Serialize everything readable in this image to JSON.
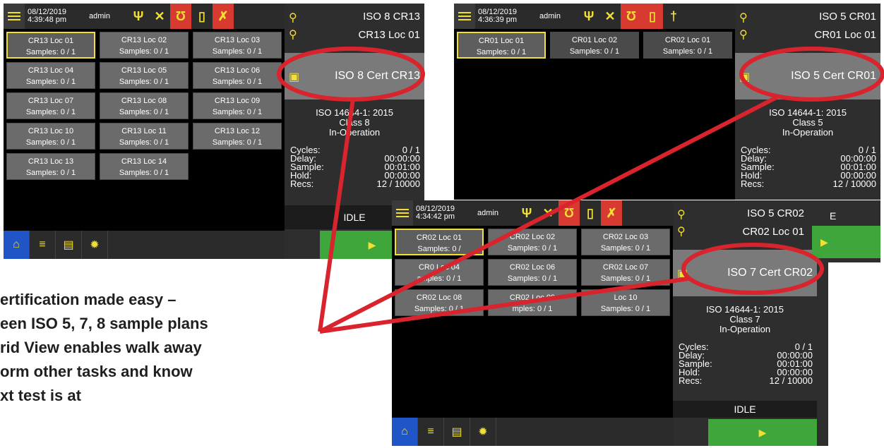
{
  "screen_a": {
    "date": "08/12/2019",
    "time": "4:39:48 pm",
    "user": "admin",
    "header_line1": "ISO 8 CR13",
    "header_line2": "CR13 Loc 01",
    "cert": "ISO 8 Cert CR13",
    "standard": "ISO 14644-1: 2015",
    "class": "Class 8",
    "mode": "In-Operation",
    "stats": [
      {
        "label": "Cycles:",
        "value": "0 / 1"
      },
      {
        "label": "Delay:",
        "value": "00:00:00"
      },
      {
        "label": "Sample:",
        "value": "00:01:00"
      },
      {
        "label": "Hold:",
        "value": "00:00:00"
      },
      {
        "label": "Recs:",
        "value": "12 / 10000"
      }
    ],
    "status": "IDLE",
    "locations": [
      {
        "name": "CR13 Loc 01",
        "samples": "Samples: 0 / 1"
      },
      {
        "name": "CR13 Loc 02",
        "samples": "Samples: 0 / 1"
      },
      {
        "name": "CR13 Loc 03",
        "samples": "Samples: 0 / 1"
      },
      {
        "name": "CR13 Loc 04",
        "samples": "Samples: 0 / 1"
      },
      {
        "name": "CR13 Loc 05",
        "samples": "Samples: 0 / 1"
      },
      {
        "name": "CR13 Loc 06",
        "samples": "Samples: 0 / 1"
      },
      {
        "name": "CR13 Loc 07",
        "samples": "Samples: 0 / 1"
      },
      {
        "name": "CR13 Loc 08",
        "samples": "Samples: 0 / 1"
      },
      {
        "name": "CR13 Loc 09",
        "samples": "Samples: 0 / 1"
      },
      {
        "name": "CR13 Loc 10",
        "samples": "Samples: 0 / 1"
      },
      {
        "name": "CR13 Loc 11",
        "samples": "Samples: 0 / 1"
      },
      {
        "name": "CR13 Loc 12",
        "samples": "Samples: 0 / 1"
      },
      {
        "name": "CR13 Loc 13",
        "samples": "Samples: 0 / 1"
      },
      {
        "name": "CR13 Loc 14",
        "samples": "Samples: 0 / 1"
      }
    ]
  },
  "screen_b": {
    "date": "08/12/2019",
    "time": "4:36:39 pm",
    "user": "admin",
    "header_line1": "ISO 5 CR01",
    "header_line2": "CR01 Loc 01",
    "cert": "ISO 5 Cert CR01",
    "standard": "ISO 14644-1: 2015",
    "class": "Class 5",
    "mode": "In-Operation",
    "stats": [
      {
        "label": "Cycles:",
        "value": "0 / 1"
      },
      {
        "label": "Delay:",
        "value": "00:00:00"
      },
      {
        "label": "Sample:",
        "value": "00:01:00"
      },
      {
        "label": "Hold:",
        "value": "00:00:00"
      },
      {
        "label": "Recs:",
        "value": "12 / 10000"
      }
    ],
    "locations": [
      {
        "name": "CR01 Loc 01",
        "samples": "Samples: 0 / 1"
      },
      {
        "name": "CR01 Loc 02",
        "samples": "Samples: 0 / 1"
      },
      {
        "name": "CR02 Loc 01",
        "samples": "Samples: 0 / 1"
      }
    ]
  },
  "screen_c": {
    "date": "08/12/2019",
    "time": "4:34:42 pm",
    "user": "admin",
    "header_line1": "ISO 5 CR02",
    "header_line2": "CR02 Loc 01",
    "cert": "ISO 7 Cert CR02",
    "standard": "ISO 14644-1: 2015",
    "class": "Class 7",
    "mode": "In-Operation",
    "stats": [
      {
        "label": "Cycles:",
        "value": "0 / 1"
      },
      {
        "label": "Delay:",
        "value": "00:00:00"
      },
      {
        "label": "Sample:",
        "value": "00:01:00"
      },
      {
        "label": "Hold:",
        "value": "00:00:00"
      },
      {
        "label": "Recs:",
        "value": "12 / 10000"
      }
    ],
    "status": "IDLE",
    "locations": [
      {
        "name": "CR02 Loc 01",
        "samples": "Samples: 0 /"
      },
      {
        "name": "CR02 Loc 02",
        "samples": "Samples: 0 / 1"
      },
      {
        "name": "CR02 Loc 03",
        "samples": "Samples: 0 / 1"
      },
      {
        "name": "CR0 Loc 04",
        "samples": "amples: 0 / 1"
      },
      {
        "name": "CR02 Loc 06",
        "samples": "Samples: 0 / 1"
      },
      {
        "name": "CR02 Loc 07",
        "samples": "Samples: 0 / 1"
      },
      {
        "name": "CR02 Loc 08",
        "samples": "Samples: 0 / 1"
      },
      {
        "name": "CR02 Loc 09",
        "samples": "mples: 0 / 1"
      },
      {
        "name": "Loc 10",
        "samples": "Samples: 0 / 1"
      }
    ]
  },
  "caption": [
    "ertification made easy –",
    "een ISO 5, 7, 8 sample plans",
    "rid View enables walk away",
    "orm other tasks and know",
    "xt test is at"
  ],
  "colors": {
    "accent_yellow": "#f2df33",
    "alert_red": "#d63a30",
    "play_green": "#3fa63b",
    "home_blue": "#1f55c7",
    "highlight_ring": "#d9232d"
  },
  "icons": [
    "menu-icon",
    "usb-icon",
    "bell-off-icon",
    "pump-icon",
    "battery-icon",
    "probe-icon",
    "location-pin-icon",
    "certificate-icon",
    "home-icon",
    "list-icon",
    "document-icon",
    "gear-icon",
    "play-icon"
  ]
}
